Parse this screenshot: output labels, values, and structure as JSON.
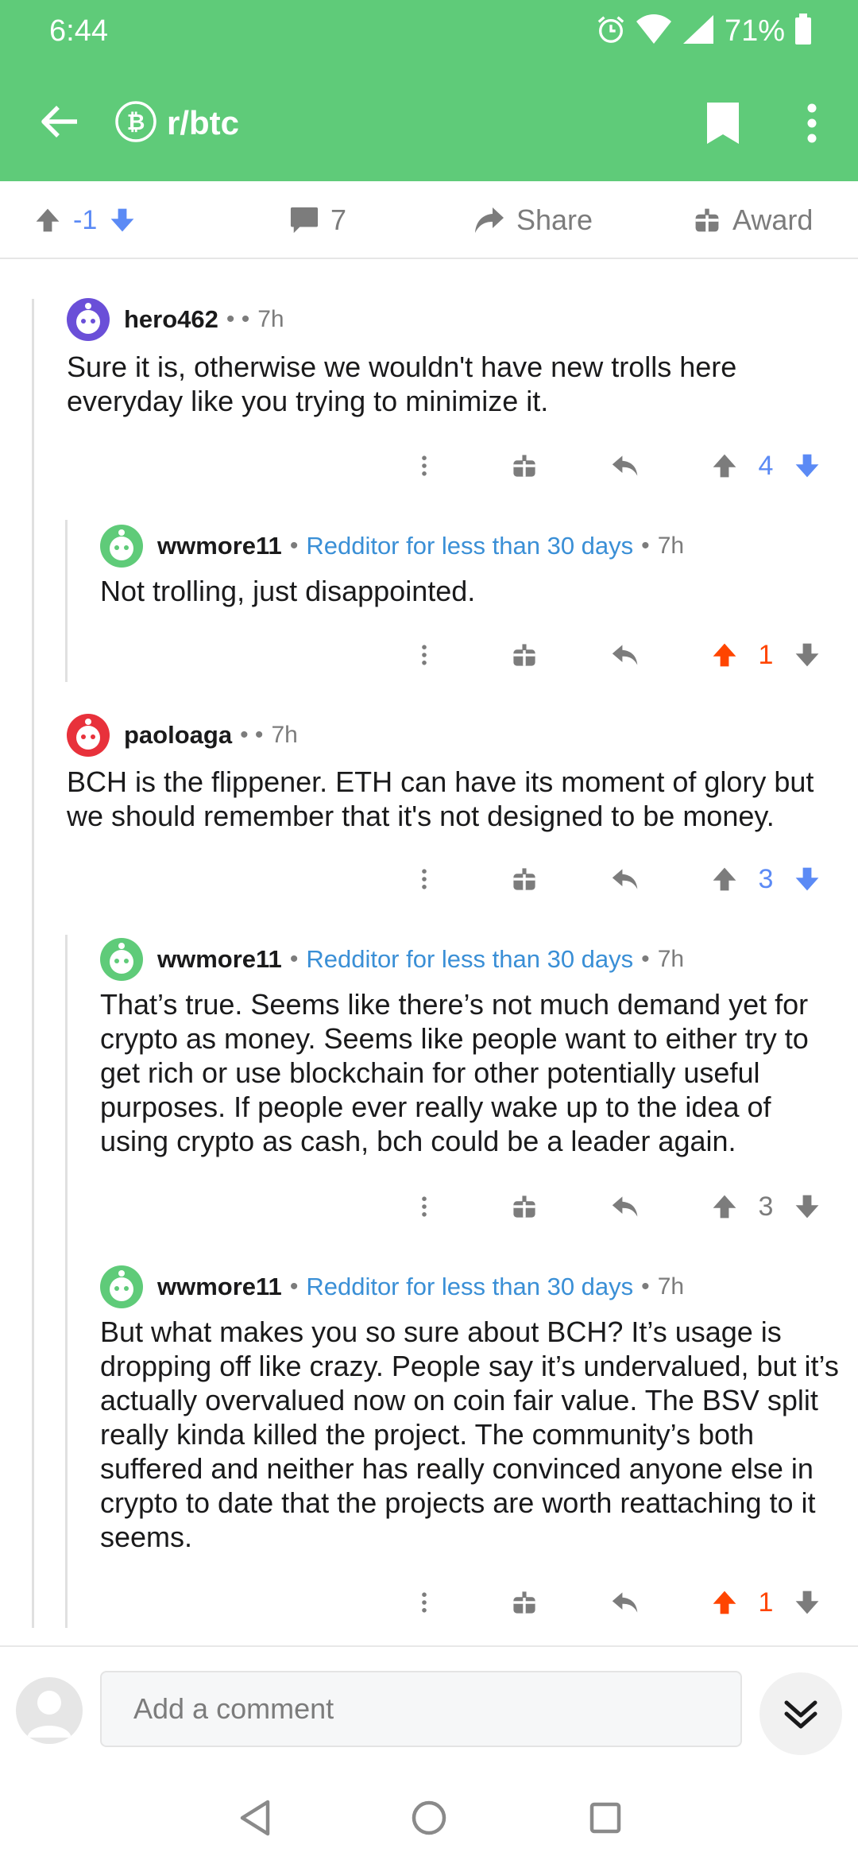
{
  "status_bar": {
    "time": "6:44",
    "battery": "71%"
  },
  "app_bar": {
    "subreddit": "r/btc"
  },
  "post_actions": {
    "score": "-1",
    "comment_count": "7",
    "share_label": "Share",
    "award_label": "Award"
  },
  "comments": [
    {
      "username": "hero462",
      "flair": "",
      "time": "7h",
      "body": "Sure it is, otherwise we wouldn't have new trolls here everyday like you trying to minimize it.",
      "score": "4",
      "vote_state": "downvoted"
    },
    {
      "username": "wwmore11",
      "flair": "Redditor for less than 30 days",
      "time": "7h",
      "body": "Not trolling, just disappointed.",
      "score": "1",
      "vote_state": "upvoted"
    },
    {
      "username": "paoloaga",
      "flair": "",
      "time": "7h",
      "body": "BCH is the flippener. ETH can have its moment of glory but we should remember that it's not designed to be money.",
      "score": "3",
      "vote_state": "downvoted"
    },
    {
      "username": "wwmore11",
      "flair": "Redditor for less than 30 days",
      "time": "7h",
      "body": "That’s true. Seems like there’s not much demand yet for crypto as money. Seems like people want to either try to get rich or use blockchain for other potentially useful purposes. If people ever really wake up to the idea of using crypto as cash, bch could be a leader again.",
      "score": "3",
      "vote_state": "none"
    },
    {
      "username": "wwmore11",
      "flair": "Redditor for less than 30 days",
      "time": "7h",
      "body": "But what makes you so sure about BCH? It’s usage is dropping off like crazy. People say it’s undervalued, but it’s actually overvalued now on coin fair value. The BSV split really kinda killed the project. The community’s both suffered and neither has really convinced anyone else in crypto to date that the projects are worth reattaching to it seems.",
      "score": "1",
      "vote_state": "upvoted"
    }
  ],
  "composer": {
    "placeholder": "Add a comment"
  },
  "colors": {
    "header": "#5fcb79",
    "upvote": "#ff4500",
    "downvote": "#5b8af5",
    "flair": "#3a8fd6"
  }
}
